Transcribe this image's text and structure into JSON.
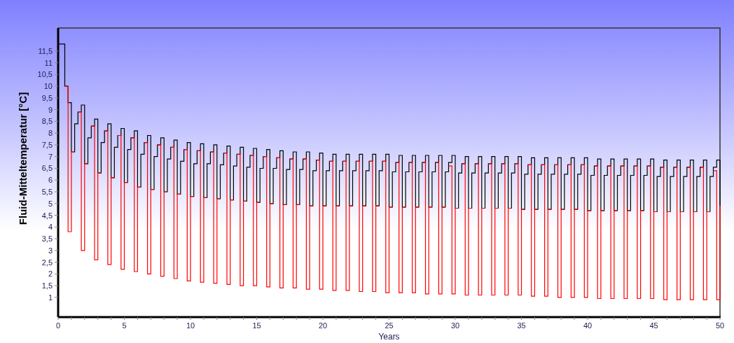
{
  "chart": {
    "chart_data": {
      "type": "line",
      "xlabel": "Years",
      "ylabel": "Fluid-Mitteltemperatur [°C]",
      "xlim": [
        0,
        50
      ],
      "ylim": [
        0.16,
        12.48
      ],
      "xticks": [
        0,
        5,
        10,
        15,
        20,
        25,
        30,
        35,
        40,
        45,
        50
      ],
      "yticks": [
        1,
        {
          "value": 1.5,
          "label": "1,5"
        },
        2,
        {
          "value": 2.5,
          "label": "2,5"
        },
        3,
        {
          "value": 3.5,
          "label": "3,5"
        },
        4,
        {
          "value": 4.5,
          "label": "4,5"
        },
        5,
        {
          "value": 5.5,
          "label": "5,5"
        },
        6,
        {
          "value": 6.5,
          "label": "6,5"
        },
        7,
        {
          "value": 7.5,
          "label": "7,5"
        },
        8,
        {
          "value": 8.5,
          "label": "8,5"
        },
        9,
        {
          "value": 9.5,
          "label": "9,5"
        },
        10,
        {
          "value": 10.5,
          "label": "10,5"
        },
        11,
        {
          "value": 11.5,
          "label": "11,5"
        }
      ],
      "x": [
        0,
        0.25,
        0.5,
        0.75,
        1,
        1.25,
        1.5,
        1.75,
        2,
        2.25,
        2.5,
        2.75,
        3,
        3.25,
        3.5,
        3.75,
        4,
        4.25,
        4.5,
        4.75,
        5,
        5.25,
        5.5,
        5.75,
        6,
        6.25,
        6.5,
        6.75,
        7,
        7.25,
        7.5,
        7.75,
        8,
        8.25,
        8.5,
        8.75,
        9,
        9.25,
        9.5,
        9.75,
        10,
        10.25,
        10.5,
        10.75,
        11,
        11.25,
        11.5,
        11.75,
        12,
        12.25,
        12.5,
        12.75,
        13,
        13.25,
        13.5,
        13.75,
        14,
        14.25,
        14.5,
        14.75,
        15,
        15.25,
        15.5,
        15.75,
        16,
        16.25,
        16.5,
        16.75,
        17,
        17.25,
        17.5,
        17.75,
        18,
        18.25,
        18.5,
        18.75,
        19,
        19.25,
        19.5,
        19.75,
        20,
        20.25,
        20.5,
        20.75,
        21,
        21.25,
        21.5,
        21.75,
        22,
        22.25,
        22.5,
        22.75,
        23,
        23.25,
        23.5,
        23.75,
        24,
        24.25,
        24.5,
        24.75,
        25,
        25.25,
        25.5,
        25.75,
        26,
        26.25,
        26.5,
        26.75,
        27,
        27.25,
        27.5,
        27.75,
        28,
        28.25,
        28.5,
        28.75,
        29,
        29.25,
        29.5,
        29.75,
        30,
        30.25,
        30.5,
        30.75,
        31,
        31.25,
        31.5,
        31.75,
        32,
        32.25,
        32.5,
        32.75,
        33,
        33.25,
        33.5,
        33.75,
        34,
        34.25,
        34.5,
        34.75,
        35,
        35.25,
        35.5,
        35.75,
        36,
        36.25,
        36.5,
        36.75,
        37,
        37.25,
        37.5,
        37.75,
        38,
        38.25,
        38.5,
        38.75,
        39,
        39.25,
        39.5,
        39.75,
        40,
        40.25,
        40.5,
        40.75,
        41,
        41.25,
        41.5,
        41.75,
        42,
        42.25,
        42.5,
        42.75,
        43,
        43.25,
        43.5,
        43.75,
        44,
        44.25,
        44.5,
        44.75,
        45,
        45.25,
        45.5,
        45.75,
        46,
        46.25,
        46.5,
        46.75,
        47,
        47.25,
        47.5,
        47.75,
        48,
        48.25,
        48.5,
        48.75,
        49,
        49.25,
        49.5,
        49.75,
        50
      ],
      "series": [
        {
          "color": "#000000",
          "values": [
            11.8,
            11.8,
            10,
            9.3,
            7.2,
            8.4,
            8.9,
            9.2,
            6.7,
            7.8,
            8.3,
            8.6,
            6.3,
            7.6,
            8.1,
            8.4,
            6.1,
            7.4,
            7.9,
            8.2,
            5.9,
            7.3,
            7.8,
            8.1,
            5.7,
            7.1,
            7.6,
            7.9,
            5.6,
            7,
            7.5,
            7.8,
            5.5,
            6.9,
            7.4,
            7.7,
            5.4,
            6.8,
            7.3,
            7.6,
            5.3,
            6.7,
            7.25,
            7.55,
            5.25,
            6.7,
            7.2,
            7.5,
            5.2,
            6.65,
            7.15,
            7.45,
            5.15,
            6.6,
            7.1,
            7.4,
            5.1,
            6.55,
            7.05,
            7.35,
            5.05,
            6.5,
            7,
            7.3,
            5,
            6.5,
            6.95,
            7.25,
            4.95,
            6.45,
            6.9,
            7.2,
            4.95,
            6.45,
            6.9,
            7.2,
            4.9,
            6.4,
            6.85,
            7.15,
            4.9,
            6.4,
            6.8,
            7.1,
            4.9,
            6.4,
            6.8,
            7.1,
            4.9,
            6.4,
            6.8,
            7.1,
            4.9,
            6.4,
            6.8,
            7.1,
            4.9,
            6.4,
            6.8,
            7.1,
            4.85,
            6.35,
            6.75,
            7.05,
            4.85,
            6.35,
            6.75,
            7.05,
            4.85,
            6.35,
            6.75,
            7.05,
            4.85,
            6.35,
            6.75,
            7.05,
            4.85,
            6.35,
            6.75,
            7.05,
            4.8,
            6.3,
            6.7,
            7,
            4.8,
            6.3,
            6.7,
            7,
            4.8,
            6.3,
            6.7,
            7,
            4.8,
            6.3,
            6.7,
            7,
            4.8,
            6.3,
            6.7,
            7,
            4.75,
            6.25,
            6.65,
            6.95,
            4.75,
            6.25,
            6.65,
            6.95,
            4.75,
            6.25,
            6.65,
            6.95,
            4.75,
            6.25,
            6.65,
            6.95,
            4.75,
            6.25,
            6.65,
            6.95,
            4.7,
            6.2,
            6.6,
            6.9,
            4.7,
            6.2,
            6.6,
            6.9,
            4.7,
            6.2,
            6.6,
            6.9,
            4.7,
            6.2,
            6.6,
            6.9,
            4.7,
            6.2,
            6.6,
            6.9,
            4.65,
            6.15,
            6.55,
            6.85,
            4.65,
            6.15,
            6.55,
            6.85,
            4.65,
            6.15,
            6.55,
            6.85,
            4.65,
            6.15,
            6.55,
            6.85,
            4.65,
            6.15,
            6.55,
            6.85,
            4.9
          ]
        },
        {
          "color": "#ff0000",
          "values": [
            null,
            null,
            10,
            3.8,
            7.2,
            null,
            8.9,
            3,
            6.7,
            null,
            8.3,
            2.6,
            6.3,
            null,
            8.1,
            2.4,
            6.1,
            null,
            7.9,
            2.2,
            5.9,
            null,
            7.8,
            2.1,
            5.7,
            null,
            7.6,
            2,
            5.6,
            null,
            7.5,
            1.9,
            5.5,
            null,
            7.4,
            1.8,
            5.4,
            null,
            7.3,
            1.7,
            5.3,
            null,
            7.25,
            1.65,
            5.25,
            null,
            7.2,
            1.6,
            5.2,
            null,
            7.15,
            1.55,
            5.15,
            null,
            7.1,
            1.5,
            5.1,
            null,
            7.05,
            1.5,
            5.05,
            null,
            7,
            1.45,
            5,
            null,
            6.95,
            1.4,
            4.95,
            null,
            6.9,
            1.4,
            4.95,
            null,
            6.9,
            1.35,
            4.9,
            null,
            6.85,
            1.35,
            4.9,
            null,
            6.8,
            1.3,
            4.9,
            null,
            6.8,
            1.3,
            4.9,
            null,
            6.8,
            1.25,
            4.9,
            null,
            6.8,
            1.25,
            4.9,
            null,
            6.8,
            1.2,
            4.85,
            null,
            6.75,
            1.2,
            4.85,
            null,
            6.75,
            1.2,
            4.85,
            null,
            6.75,
            1.15,
            4.85,
            null,
            6.75,
            1.15,
            4.85,
            null,
            6.6,
            1.15,
            4.8,
            null,
            6.7,
            1.1,
            4.8,
            null,
            6.7,
            1.1,
            4.8,
            null,
            6.7,
            1.1,
            4.8,
            null,
            6.7,
            1.1,
            4.8,
            null,
            6.7,
            1.1,
            4.75,
            null,
            6.65,
            1.05,
            4.75,
            null,
            6.65,
            1.05,
            4.75,
            null,
            6.65,
            1,
            4.75,
            null,
            6.65,
            1,
            4.75,
            null,
            6.65,
            1,
            4.7,
            null,
            6.6,
            0.95,
            4.7,
            null,
            6.6,
            0.95,
            4.7,
            null,
            6.6,
            0.95,
            4.7,
            null,
            6.6,
            0.95,
            4.7,
            null,
            6.6,
            0.95,
            4.65,
            null,
            6.55,
            0.9,
            4.65,
            null,
            6.55,
            0.9,
            4.65,
            null,
            6.55,
            0.9,
            4.65,
            null,
            6.55,
            0.9,
            4.65,
            null,
            6.4,
            0.9,
            4.9
          ]
        }
      ]
    }
  }
}
